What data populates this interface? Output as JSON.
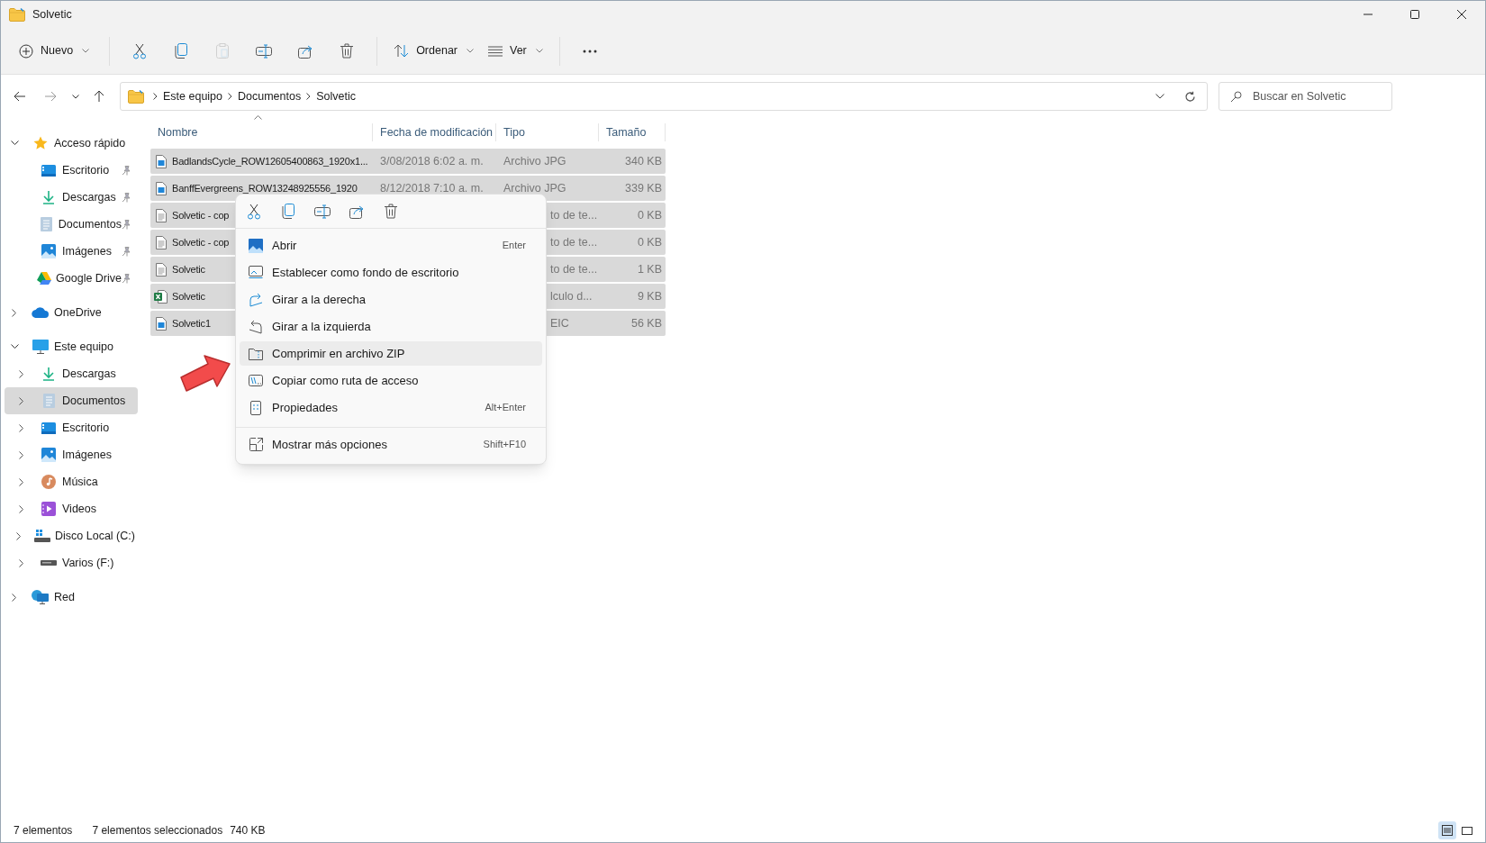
{
  "window": {
    "title": "Solvetic"
  },
  "toolbar": {
    "items": [
      {
        "kind": "new",
        "label": "Nuevo",
        "disabled": false
      },
      {
        "kind": "cut",
        "disabled": false
      },
      {
        "kind": "copy",
        "disabled": false
      },
      {
        "kind": "paste",
        "disabled": true
      },
      {
        "kind": "rename",
        "disabled": false
      },
      {
        "kind": "share",
        "disabled": false
      },
      {
        "kind": "delete",
        "disabled": false
      },
      {
        "kind": "sort",
        "label": "Ordenar",
        "disabled": false
      },
      {
        "kind": "view",
        "label": "Ver",
        "disabled": false
      },
      {
        "kind": "more",
        "disabled": false
      }
    ]
  },
  "address_bar": {
    "breadcrumbs": [
      "Este equipo",
      "Documentos",
      "Solvetic"
    ]
  },
  "search": {
    "placeholder": "Buscar en Solvetic"
  },
  "sidebar": {
    "items": [
      {
        "kind": "star",
        "label": "Acceso rápido",
        "expanded": true,
        "selected": false,
        "children": [
          {
            "kind": "desktop",
            "label": "Escritorio",
            "pinned": true,
            "selected": false
          },
          {
            "kind": "download",
            "label": "Descargas",
            "pinned": true,
            "selected": false
          },
          {
            "kind": "document",
            "label": "Documentos",
            "pinned": true,
            "selected": false
          },
          {
            "kind": "image",
            "label": "Imágenes",
            "pinned": true,
            "selected": false
          },
          {
            "kind": "drive",
            "label": "Google Drive",
            "pinned": true,
            "selected": false
          }
        ]
      },
      {
        "kind": "cloud",
        "label": "OneDrive",
        "expanded": false,
        "selected": false
      },
      {
        "kind": "computer",
        "label": "Este equipo",
        "expanded": true,
        "selected": false,
        "children": [
          {
            "kind": "download",
            "label": "Descargas",
            "expanded": false,
            "selected": false
          },
          {
            "kind": "document",
            "label": "Documentos",
            "expanded": false,
            "selected": true
          },
          {
            "kind": "desktop",
            "label": "Escritorio",
            "expanded": false,
            "selected": false
          },
          {
            "kind": "image",
            "label": "Imágenes",
            "expanded": false,
            "selected": false
          },
          {
            "kind": "music",
            "label": "Música",
            "expanded": false,
            "selected": false
          },
          {
            "kind": "video",
            "label": "Videos",
            "expanded": false,
            "selected": false
          },
          {
            "kind": "disk",
            "label": "Disco Local (C:)",
            "expanded": false,
            "selected": false
          },
          {
            "kind": "drive-bar",
            "label": "Varios (F:)",
            "expanded": false,
            "selected": false
          }
        ]
      },
      {
        "kind": "network",
        "label": "Red",
        "expanded": false,
        "selected": false
      }
    ]
  },
  "table": {
    "columns": [
      "Nombre",
      "Fecha de modificación",
      "Tipo",
      "Tamaño"
    ],
    "rows": [
      {
        "kind": "image",
        "name": "BadlandsCycle_ROW12605400863_1920x1...",
        "date": "3/08/2018 6:02 a. m.",
        "type": "Archivo JPG",
        "size": "340 KB",
        "selected": true
      },
      {
        "kind": "image",
        "name": "BanffEvergreens_ROW13248925556_1920",
        "date": "8/12/2018 7:10 a. m.",
        "type": "Archivo JPG",
        "size": "339 KB",
        "selected": true
      },
      {
        "kind": "text",
        "name": "Solvetic - cop",
        "type": "to de te...",
        "size": "0 KB",
        "selected": true
      },
      {
        "kind": "text",
        "name": "Solvetic - cop",
        "type": "to de te...",
        "size": "0 KB",
        "selected": true
      },
      {
        "kind": "text",
        "name": "Solvetic",
        "type": "to de te...",
        "size": "1 KB",
        "selected": true
      },
      {
        "kind": "spreadsheet",
        "name": "Solvetic",
        "type": "lculo d...",
        "size": "9 KB",
        "selected": true
      },
      {
        "kind": "image",
        "name": "Solvetic1",
        "type": "EIC",
        "size": "56 KB",
        "selected": true
      }
    ]
  },
  "context_menu": {
    "actions": [
      {
        "kind": "cut"
      },
      {
        "kind": "copy"
      },
      {
        "kind": "rename"
      },
      {
        "kind": "share"
      },
      {
        "kind": "delete"
      }
    ],
    "sections": [
      [
        {
          "kind": "open",
          "label": "Abrir",
          "shortcut": "Enter",
          "selected": false
        },
        {
          "kind": "wallpaper",
          "label": "Establecer como fondo de escritorio",
          "selected": false
        },
        {
          "kind": "rotate-right",
          "label": "Girar a la derecha",
          "selected": false
        },
        {
          "kind": "rotate-left",
          "label": "Girar a la izquierda",
          "selected": false
        },
        {
          "kind": "zip",
          "label": "Comprimir en archivo ZIP",
          "selected": true
        },
        {
          "kind": "path",
          "label": "Copiar como ruta de acceso",
          "selected": false
        },
        {
          "kind": "properties",
          "label": "Propiedades",
          "shortcut": "Alt+Enter",
          "selected": false
        }
      ],
      [
        {
          "kind": "more",
          "label": "Mostrar más opciones",
          "shortcut": "Shift+F10",
          "selected": false
        }
      ]
    ]
  },
  "status_bar": {
    "count": "7 elementos",
    "selection": "7 elementos seleccionados",
    "size": "740 KB",
    "view_modes": [
      {
        "kind": "details",
        "selected": true
      },
      {
        "kind": "tiles",
        "selected": false
      }
    ]
  }
}
